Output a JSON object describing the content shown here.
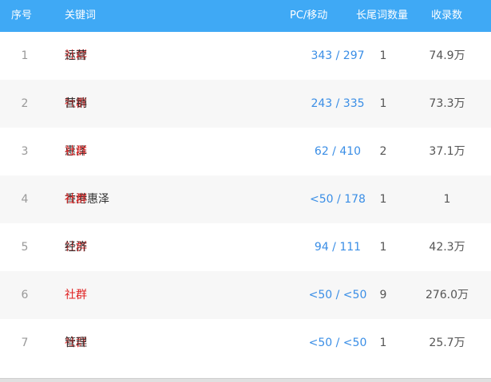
{
  "header": {
    "index": "序号",
    "keyword": "关键词",
    "pc_mobile": "PC/移动",
    "longtail": "长尾词数量",
    "indexed": "收录数"
  },
  "rows": [
    {
      "index": "1",
      "kw_pre": "",
      "kw_hl": "社群",
      "kw_post": "运营",
      "pc_mobile": "343 / 297",
      "longtail": "1",
      "indexed": "74.9万"
    },
    {
      "index": "2",
      "kw_pre": "",
      "kw_hl": "社群",
      "kw_post": "营销",
      "pc_mobile": "243 / 335",
      "longtail": "1",
      "indexed": "73.3万"
    },
    {
      "index": "3",
      "kw_pre": "惠泽",
      "kw_hl": "社群",
      "kw_post": "",
      "pc_mobile": "62 / 410",
      "longtail": "2",
      "indexed": "37.1万"
    },
    {
      "index": "4",
      "kw_pre": "香港惠泽",
      "kw_hl": "社群",
      "kw_post": "",
      "pc_mobile": "<50 / 178",
      "longtail": "1",
      "indexed": "1"
    },
    {
      "index": "5",
      "kw_pre": "",
      "kw_hl": "社群",
      "kw_post": "经济",
      "pc_mobile": "94 / 111",
      "longtail": "1",
      "indexed": "42.3万"
    },
    {
      "index": "6",
      "kw_pre": "",
      "kw_hl": "社群",
      "kw_post": "",
      "pc_mobile": "<50 / <50",
      "longtail": "9",
      "indexed": "276.0万"
    },
    {
      "index": "7",
      "kw_pre": "",
      "kw_hl": "社群",
      "kw_post": "管理",
      "pc_mobile": "<50 / <50",
      "longtail": "1",
      "indexed": "25.7万"
    }
  ]
}
